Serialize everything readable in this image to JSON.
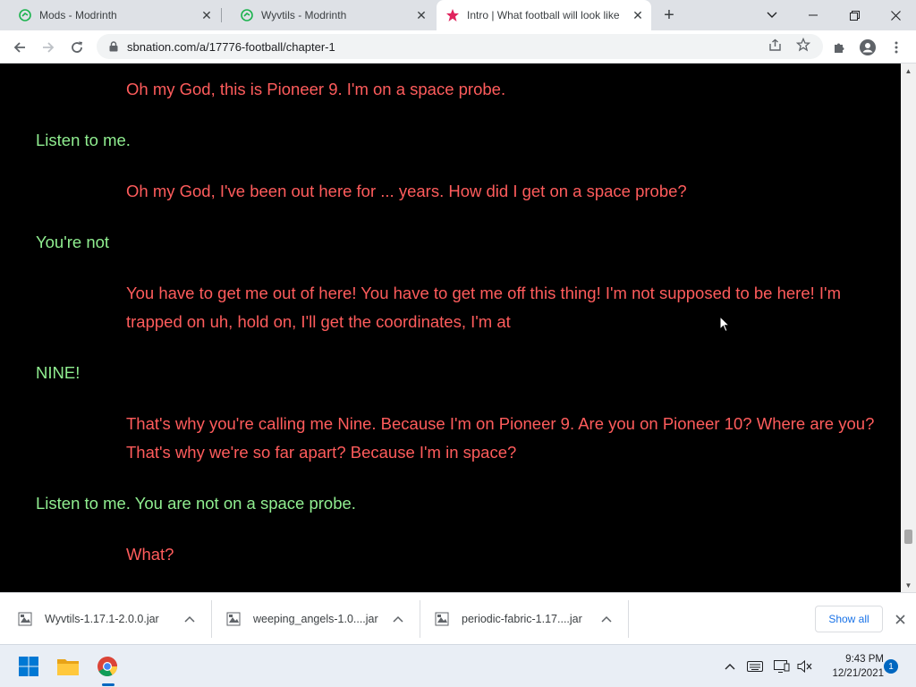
{
  "browser": {
    "tabs": [
      {
        "title": "Mods - Modrinth",
        "active": false
      },
      {
        "title": "Wyvtils - Modrinth",
        "active": false
      },
      {
        "title": "Intro | What football will look like",
        "active": true
      }
    ],
    "new_tab_label": "+",
    "address": "sbnation.com/a/17776-football/chapter-1"
  },
  "page": {
    "lines": [
      {
        "speaker": "red",
        "text": "Oh my God, this is Pioneer 9. I'm on a space probe."
      },
      {
        "speaker": "green",
        "text": "Listen to me."
      },
      {
        "speaker": "red",
        "text": "Oh my God, I've been out here for ... years. How did I get on a space probe?"
      },
      {
        "speaker": "green",
        "text": "You're not"
      },
      {
        "speaker": "red",
        "text": "You have to get me out of here! You have to get me off this thing! I'm not supposed to be here! I'm trapped on uh, hold on, I'll get the coordinates, I'm at"
      },
      {
        "speaker": "green",
        "text": "NINE!"
      },
      {
        "speaker": "red",
        "text": "That's why you're calling me Nine. Because I'm on Pioneer 9. Are you on Pioneer 10? Where are you? That's why we're so far apart? Because I'm in space?"
      },
      {
        "speaker": "green",
        "text": "Listen to me. You are not on a space probe."
      },
      {
        "speaker": "red",
        "text": "What?"
      }
    ],
    "colors": {
      "green": "#90ee90",
      "red": "#ff5c5c",
      "background": "#000000"
    }
  },
  "downloads": {
    "items": [
      {
        "name": "Wyvtils-1.17.1-2.0.0.jar"
      },
      {
        "name": "weeping_angels-1.0....jar"
      },
      {
        "name": "periodic-fabric-1.17....jar"
      }
    ],
    "show_all": "Show all"
  },
  "taskbar": {
    "time": "9:43 PM",
    "date": "12/21/2021",
    "notification_count": "1"
  }
}
